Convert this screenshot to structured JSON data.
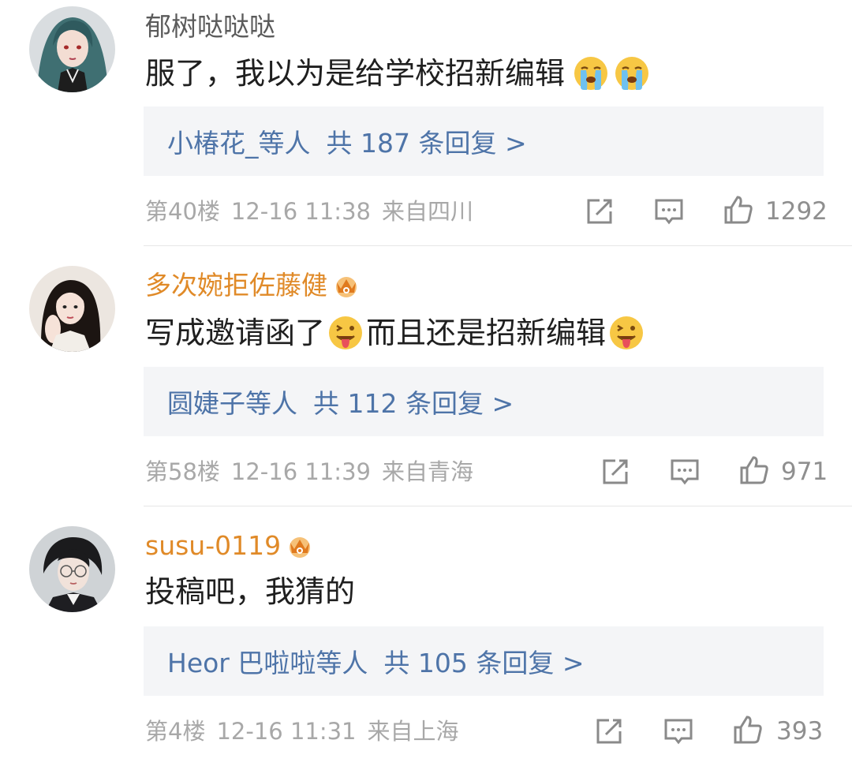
{
  "comments": [
    {
      "username": "郁树哒哒哒",
      "content": "服了，我以为是给学校招新编辑",
      "emojis": [
        "crying-face",
        "crying-face"
      ],
      "reply_names": "小椿花_等人",
      "reply_count": "共 187 条回复 >",
      "floor": "第40楼",
      "time": "12-16 11:38",
      "location": "来自四川",
      "likes": "1292"
    },
    {
      "username": "多次婉拒佐藤健",
      "content_parts": [
        "写成邀请函了",
        "而且还是招新编辑"
      ],
      "emojis": [
        "tongue-out-face",
        "tongue-out-face"
      ],
      "reply_names": "圆婕子等人",
      "reply_count": "共 112 条回复 >",
      "floor": "第58楼",
      "time": "12-16 11:39",
      "location": "来自青海",
      "likes": "971"
    },
    {
      "username": "susu-0119",
      "content": "投稿吧，我猜的",
      "reply_names": "Heor 巴啦啦等人",
      "reply_count": "共 105 条回复 >",
      "floor": "第4楼",
      "time": "12-16 11:31",
      "location": "来自上海",
      "likes": "393"
    }
  ],
  "colors": {
    "username_plain": "#5b5b5b",
    "username_vip": "#e08a28",
    "reply_link": "#4e74a8",
    "reply_bg": "#f4f5f7",
    "meta_text": "#a8a8a8"
  },
  "icons": [
    "repost-icon",
    "comment-icon",
    "like-icon",
    "vip-crown-icon"
  ]
}
